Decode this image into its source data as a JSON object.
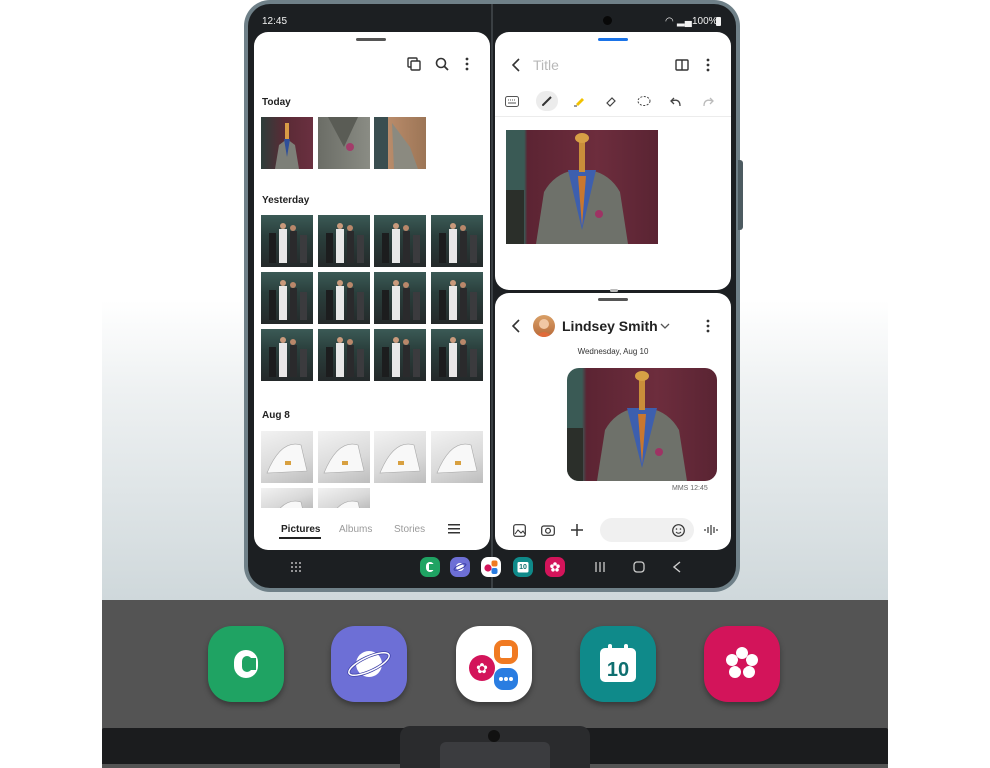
{
  "status_bar": {
    "time": "12:45",
    "battery": "100%"
  },
  "gallery": {
    "sections": [
      {
        "label": "Today"
      },
      {
        "label": "Yesterday"
      },
      {
        "label": "Aug 8"
      }
    ],
    "tabs": [
      {
        "label": "Pictures",
        "active": true
      },
      {
        "label": "Albums",
        "active": false
      },
      {
        "label": "Stories",
        "active": false
      }
    ],
    "toolbar_icons": [
      "select-icon",
      "search-icon",
      "more-icon",
      "menu-icon"
    ]
  },
  "notes": {
    "title_placeholder": "Title",
    "tools": [
      "keyboard-icon",
      "pen-icon",
      "highlighter-icon",
      "eraser-icon",
      "lasso-icon",
      "undo-icon",
      "redo-icon"
    ]
  },
  "messages": {
    "contact_name": "Lindsey Smith",
    "date": "Wednesday, Aug 10",
    "meta": "MMS 12:45"
  },
  "taskbar": {
    "apps": [
      "phone-app",
      "internet-app",
      "samsung-folder",
      "calendar-app",
      "gallery-app"
    ],
    "calendar_day": "10",
    "nav": [
      "recents-icon",
      "home-icon",
      "back-icon"
    ]
  },
  "colors": {
    "phone_green": "#1fa363",
    "internet_purple": "#6d6fd6",
    "calendar_teal": "#0f8a8a",
    "gallery_magenta": "#d3145a",
    "notes_accent": "#1a73e8"
  }
}
